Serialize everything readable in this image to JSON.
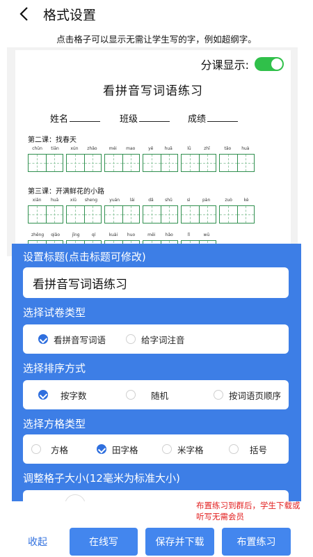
{
  "header": {
    "title": "格式设置"
  },
  "hint": "点击格子可以显示无需让学生写的字，例如超纲字。",
  "paper": {
    "split_label": "分课显示:",
    "title": "看拼音写词语练习",
    "name_label": "姓名",
    "class_label": "班级",
    "score_label": "成绩",
    "lessons": [
      {
        "title": "第二课：找春天",
        "words": [
          [
            "chūn",
            "tiān"
          ],
          [
            "xún",
            "zhǎo"
          ],
          [
            "méi",
            "mao"
          ],
          [
            "yě",
            "huā"
          ],
          [
            "lǜ",
            "zhī"
          ],
          [
            "tǎo",
            "huà"
          ]
        ]
      },
      {
        "title": "第三课：开满鲜花的小路",
        "words": [
          [
            "xiān",
            "huā"
          ],
          [
            "xiū",
            "sheng"
          ],
          [
            "yuán",
            "lái"
          ],
          [
            "dǎ",
            "shǔ"
          ],
          [
            "sì",
            "pàn"
          ],
          [
            "zuò",
            "kè"
          ]
        ]
      },
      {
        "title": "",
        "words": [
          [
            "zhēng",
            "qiǎo"
          ],
          [
            "jīng",
            "qí"
          ],
          [
            "kuài",
            "huo"
          ],
          [
            "měi",
            "hǎo"
          ],
          [
            "lǐ",
            "wū"
          ]
        ]
      }
    ]
  },
  "settings": {
    "title_label": "设置标题(点击标题可修改)",
    "title_value": "看拼音写词语练习",
    "type_label": "选择试卷类型",
    "type_options": [
      "看拼音写词语",
      "给字词注音"
    ],
    "sort_label": "选择排序方式",
    "sort_options": [
      "按字数",
      "随机",
      "按词语页顺序"
    ],
    "grid_label": "选择方格类型",
    "grid_options": [
      "方格",
      "田字格",
      "米字格",
      "括号"
    ],
    "size_label": "调整格子大小(12毫米为标准大小)"
  },
  "note": "布置练习到群后，学生下载或听写无需会员",
  "footer": {
    "collapse": "收起",
    "online": "在线写",
    "save": "保存并下载",
    "assign": "布置练习"
  },
  "colors": {
    "accent": "#3d7ee6",
    "toggle_on": "#30c04a",
    "grid": "#2f8f4e",
    "note": "#e22020"
  }
}
